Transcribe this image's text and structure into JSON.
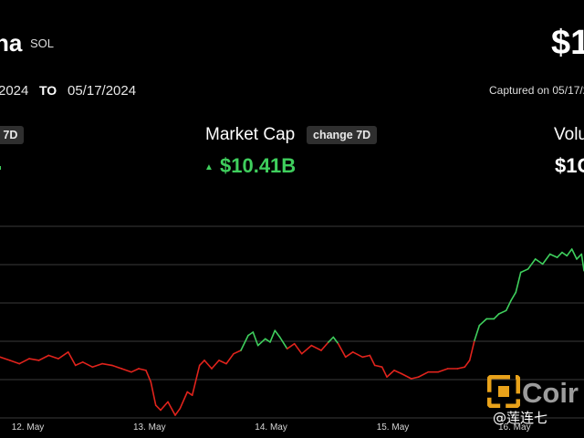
{
  "header": {
    "name_fragment": "na",
    "symbol": "SOL",
    "price_fragment": "$1"
  },
  "range": {
    "from_fragment": "2024",
    "to_label": "TO",
    "to_date": "05/17/2024",
    "captured_fragment": "Captured on 05/17/2"
  },
  "stats": {
    "left_chip_fragment": "e 7D",
    "market_cap_label": "Market Cap",
    "market_cap_chip": "change 7D",
    "market_cap_arrow": "▲",
    "market_cap_value": "$10.41B",
    "volume_label_fragment": "Volu",
    "volume_value_fragment": "$1C"
  },
  "colors": {
    "background": "#000000",
    "up": "#3fcf5d",
    "down": "#e0231c",
    "grid": "#3a3a3a"
  },
  "chart_data": {
    "type": "line",
    "x_tick_labels": [
      "12. May",
      "13. May",
      "14. May",
      "15. May",
      "16. May"
    ],
    "x_range": [
      11.92,
      16.72
    ],
    "y_range_relative": [
      0,
      1
    ],
    "grid": true,
    "series": [
      {
        "values": [
          [
            11.92,
            0.35
          ],
          [
            12.0,
            0.33
          ],
          [
            12.08,
            0.31
          ],
          [
            12.16,
            0.34
          ],
          [
            12.24,
            0.33
          ],
          [
            12.32,
            0.36
          ],
          [
            12.4,
            0.34
          ],
          [
            12.48,
            0.38
          ],
          [
            12.54,
            0.3
          ],
          [
            12.6,
            0.32
          ],
          [
            12.68,
            0.29
          ],
          [
            12.76,
            0.31
          ],
          [
            12.84,
            0.3
          ],
          [
            12.92,
            0.28
          ],
          [
            13.0,
            0.26
          ],
          [
            13.06,
            0.28
          ],
          [
            13.12,
            0.27
          ],
          [
            13.16,
            0.2
          ],
          [
            13.2,
            0.06
          ],
          [
            13.24,
            0.03
          ],
          [
            13.3,
            0.08
          ],
          [
            13.36,
            0.0
          ],
          [
            13.4,
            0.04
          ],
          [
            13.46,
            0.14
          ],
          [
            13.5,
            0.12
          ],
          [
            13.56,
            0.3
          ],
          [
            13.6,
            0.33
          ],
          [
            13.66,
            0.28
          ],
          [
            13.72,
            0.33
          ],
          [
            13.78,
            0.31
          ],
          [
            13.84,
            0.37
          ],
          [
            13.9,
            0.39
          ],
          [
            13.96,
            0.48
          ],
          [
            14.0,
            0.5
          ],
          [
            14.04,
            0.42
          ],
          [
            14.1,
            0.46
          ],
          [
            14.14,
            0.44
          ],
          [
            14.18,
            0.51
          ],
          [
            14.22,
            0.47
          ],
          [
            14.28,
            0.4
          ],
          [
            14.34,
            0.43
          ],
          [
            14.4,
            0.37
          ],
          [
            14.48,
            0.42
          ],
          [
            14.56,
            0.39
          ],
          [
            14.62,
            0.44
          ],
          [
            14.66,
            0.47
          ],
          [
            14.7,
            0.43
          ],
          [
            14.76,
            0.35
          ],
          [
            14.82,
            0.38
          ],
          [
            14.9,
            0.35
          ],
          [
            14.96,
            0.36
          ],
          [
            15.0,
            0.3
          ],
          [
            15.06,
            0.29
          ],
          [
            15.1,
            0.23
          ],
          [
            15.16,
            0.27
          ],
          [
            15.22,
            0.25
          ],
          [
            15.3,
            0.22
          ],
          [
            15.36,
            0.23
          ],
          [
            15.44,
            0.26
          ],
          [
            15.52,
            0.26
          ],
          [
            15.6,
            0.28
          ],
          [
            15.68,
            0.28
          ],
          [
            15.74,
            0.29
          ],
          [
            15.78,
            0.33
          ],
          [
            15.82,
            0.45
          ],
          [
            15.86,
            0.54
          ],
          [
            15.92,
            0.58
          ],
          [
            15.98,
            0.58
          ],
          [
            16.02,
            0.61
          ],
          [
            16.08,
            0.63
          ],
          [
            16.12,
            0.69
          ],
          [
            16.16,
            0.74
          ],
          [
            16.2,
            0.86
          ],
          [
            16.26,
            0.88
          ],
          [
            16.32,
            0.94
          ],
          [
            16.38,
            0.91
          ],
          [
            16.44,
            0.97
          ],
          [
            16.5,
            0.95
          ],
          [
            16.54,
            0.98
          ],
          [
            16.58,
            0.96
          ],
          [
            16.62,
            1.0
          ],
          [
            16.66,
            0.94
          ],
          [
            16.7,
            0.97
          ],
          [
            16.72,
            0.87
          ]
        ]
      }
    ]
  },
  "branding": {
    "logo_icon": "coinglass-logo-icon",
    "logo_text_fragment": "Coir",
    "watermark": "@莲连七"
  }
}
